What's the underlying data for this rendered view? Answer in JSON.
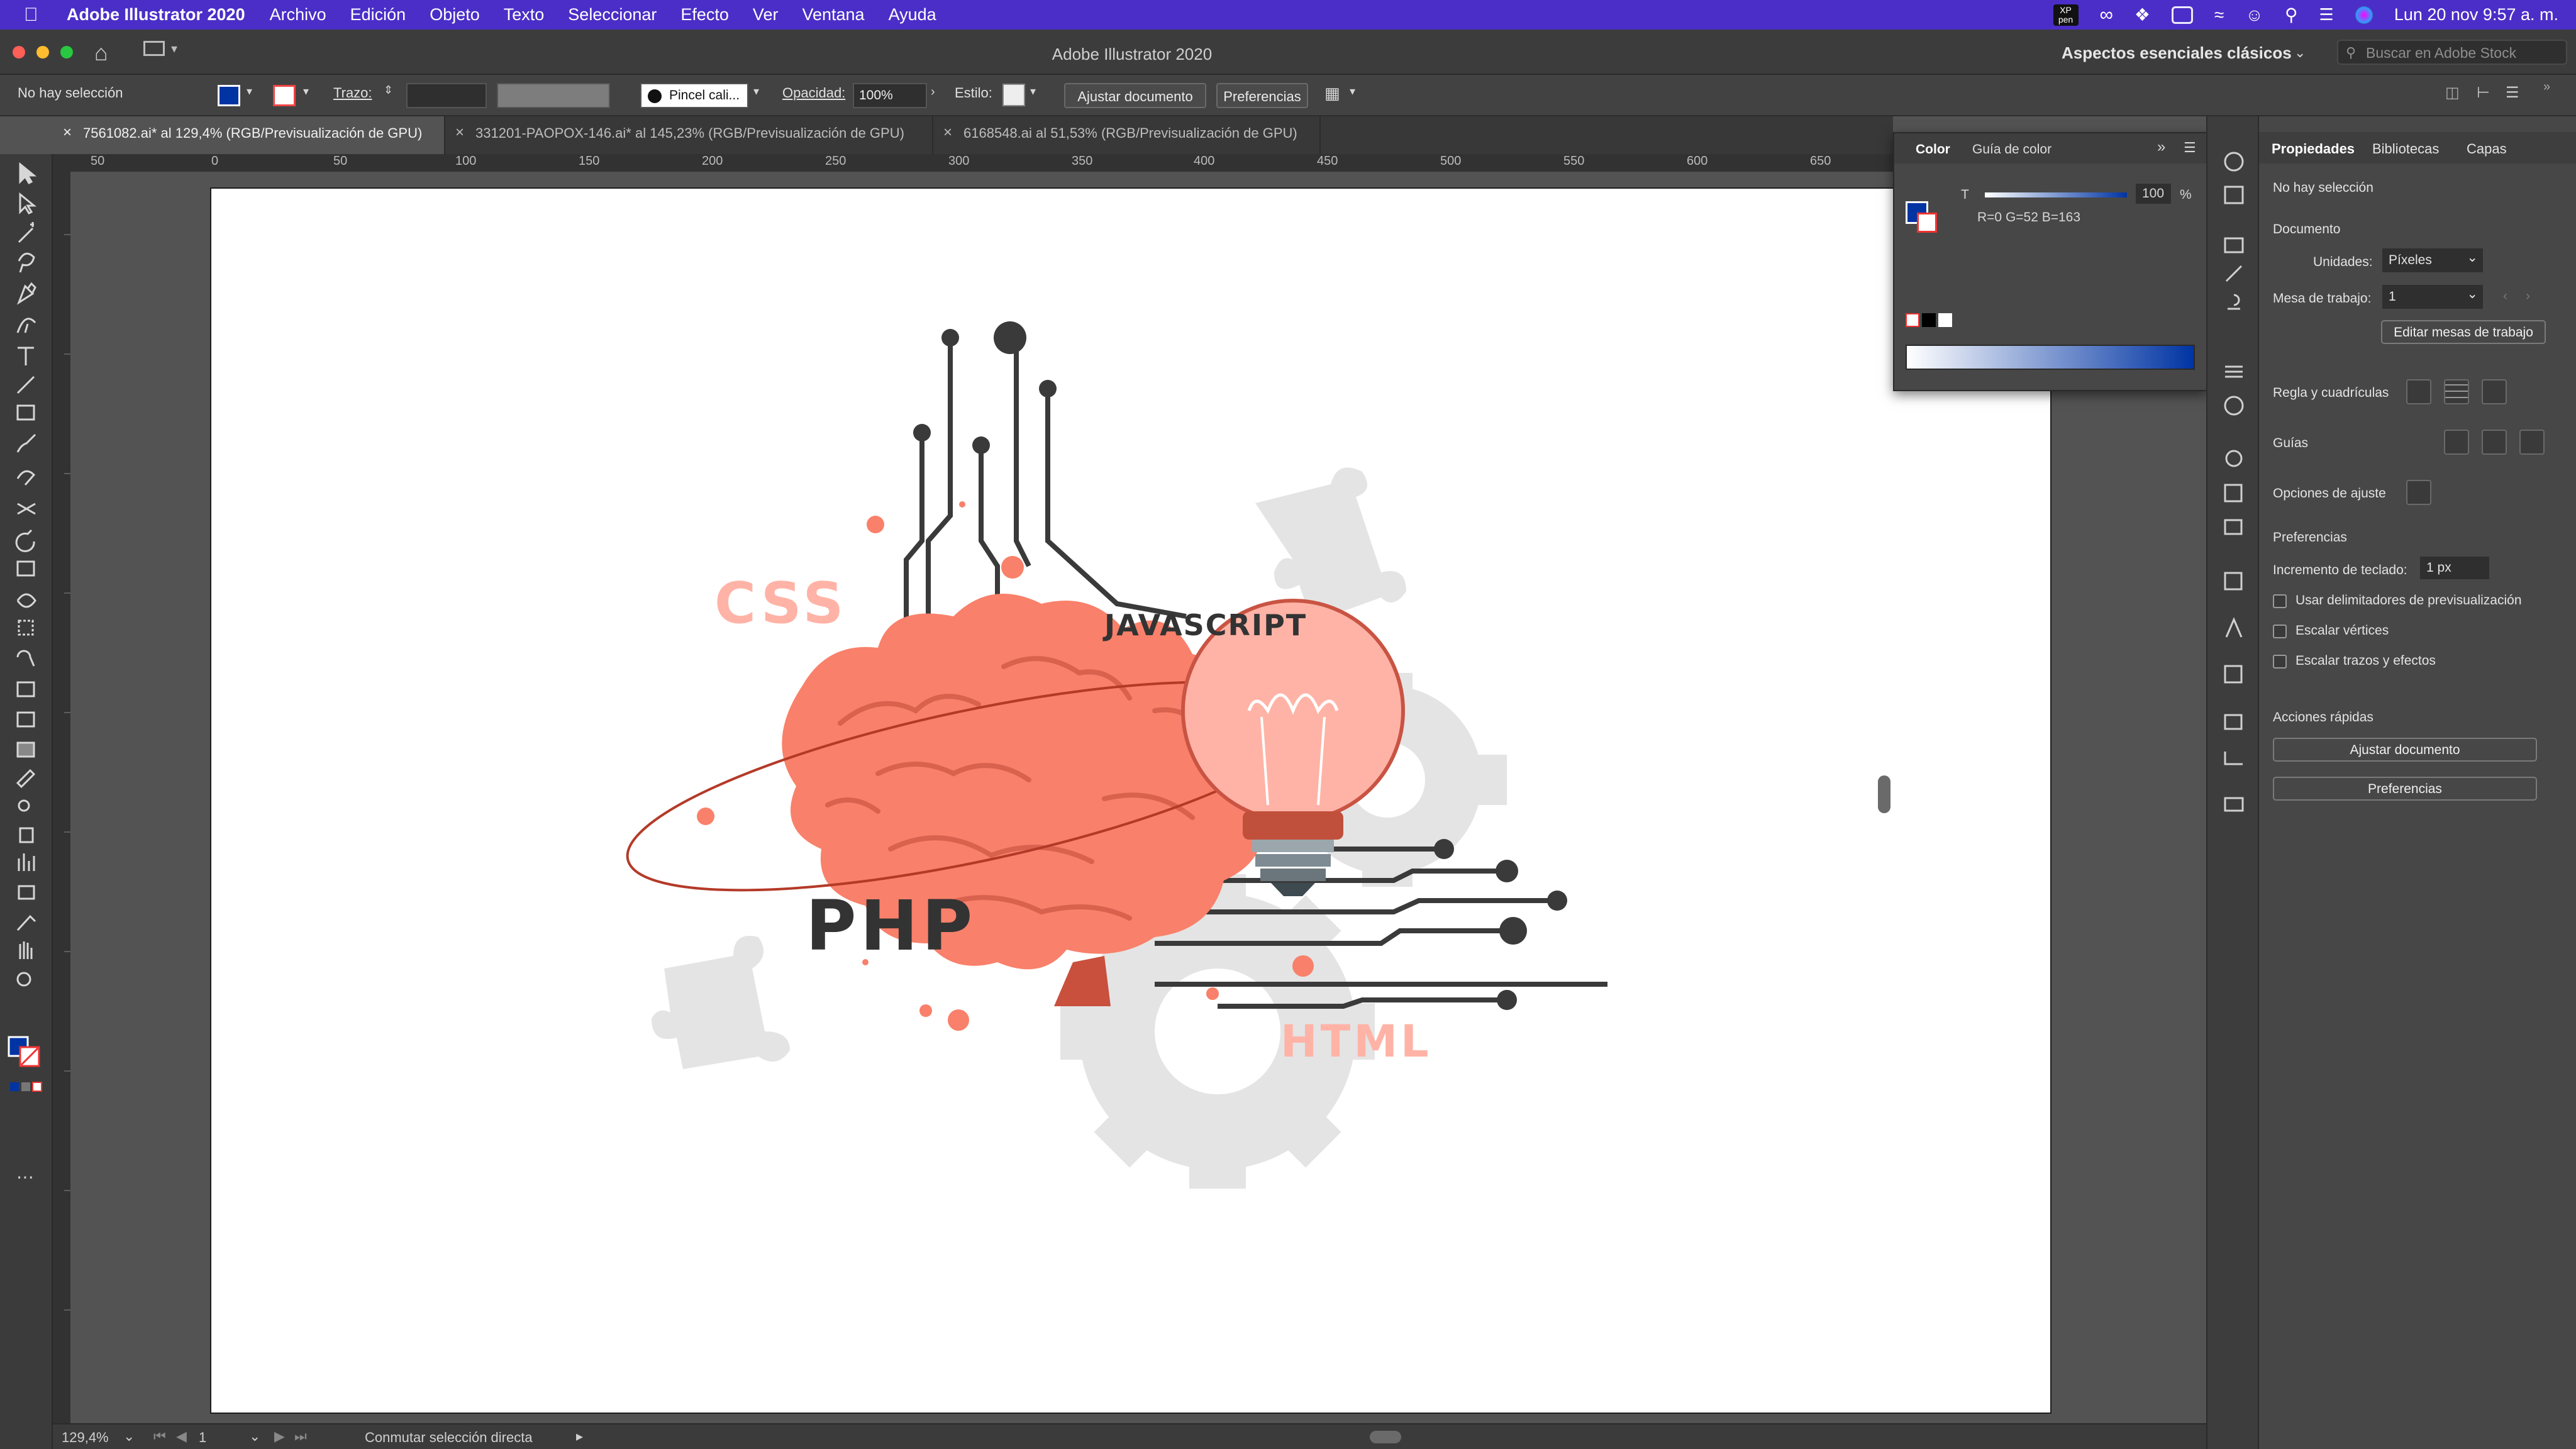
{
  "menubar": {
    "app_name": "Adobe Illustrator 2020",
    "items": [
      "Archivo",
      "Edición",
      "Objeto",
      "Texto",
      "Seleccionar",
      "Efecto",
      "Ver",
      "Ventana",
      "Ayuda"
    ],
    "date_time": "Lun 20 nov  9:57 a. m.",
    "xp_pen_label": "XP pen"
  },
  "window": {
    "title": "Adobe Illustrator 2020",
    "workspace": "Aspectos esenciales clásicos",
    "stock_search_placeholder": "Buscar en Adobe Stock"
  },
  "controlbar": {
    "selection_status": "No hay selección",
    "stroke_label": "Trazo:",
    "brush_label": "Pincel cali...",
    "opacity_label": "Opacidad:",
    "opacity_value": "100%",
    "style_label": "Estilo:",
    "fit_document_button": "Ajustar documento",
    "preferences_button": "Preferencias"
  },
  "tabs": [
    {
      "label": "7561082.ai* al 129,4% (RGB/Previsualización de GPU)",
      "active": true
    },
    {
      "label": "331201-PAOPOX-146.ai* al 145,23% (RGB/Previsualización de GPU)",
      "active": false
    },
    {
      "label": "6168548.ai al 51,53% (RGB/Previsualización de GPU)",
      "active": false
    }
  ],
  "ruler": {
    "h_labels": [
      "50",
      "0",
      "50",
      "100",
      "150",
      "200",
      "250",
      "300",
      "350",
      "400",
      "450",
      "500",
      "550",
      "600",
      "650"
    ],
    "v_labels": [
      "0",
      "5",
      "0",
      "1",
      "0",
      "0",
      "1",
      "5",
      "0",
      "2",
      "0",
      "0",
      "2",
      "5",
      "0",
      "3",
      "0",
      "0",
      "3",
      "5",
      "0",
      "4",
      "0",
      "0",
      "4",
      "5",
      "0",
      "5",
      "0",
      "0"
    ]
  },
  "artwork": {
    "css_text": "CSS",
    "javascript_text": "JAVASCRIPT",
    "php_text": "PHP",
    "html_text": "HTML",
    "colors": {
      "brain": "#f9806a",
      "brain_dark": "#d76552",
      "circuit": "#3a3a3a",
      "puzzle_gray": "#e4e4e4",
      "bulb": "#ffb3a6",
      "bulb_base": "#c0503b"
    }
  },
  "color_panel": {
    "tab_color": "Color",
    "tab_guide": "Guía de color",
    "t_label": "T",
    "t_value": "100",
    "percent": "%",
    "rgb_readout": "R=0 G=52 B=163",
    "fill_color": "#0034a3"
  },
  "properties": {
    "tabs": [
      "Propiedades",
      "Bibliotecas",
      "Capas"
    ],
    "no_selection": "No hay selección",
    "document_heading": "Documento",
    "units_label": "Unidades:",
    "units_value": "Píxeles",
    "artboard_label": "Mesa de trabajo:",
    "artboard_value": "1",
    "edit_artboards_button": "Editar mesas de trabajo",
    "ruler_grid_label": "Regla y cuadrículas",
    "guides_label": "Guías",
    "snap_label": "Opciones de ajuste",
    "preferences_heading": "Preferencias",
    "keyboard_increment_label": "Incremento de teclado:",
    "keyboard_increment_value": "1 px",
    "checkbox_preview_bounds": "Usar delimitadores de previsualización",
    "checkbox_scale_corners": "Escalar vértices",
    "checkbox_scale_strokes": "Escalar trazos y efectos",
    "quick_actions_heading": "Acciones rápidas",
    "fit_document_button": "Ajustar documento",
    "preferences_button": "Preferencias"
  },
  "status": {
    "zoom": "129,4%",
    "artboard_number": "1",
    "status_text": "Conmutar selección directa"
  }
}
